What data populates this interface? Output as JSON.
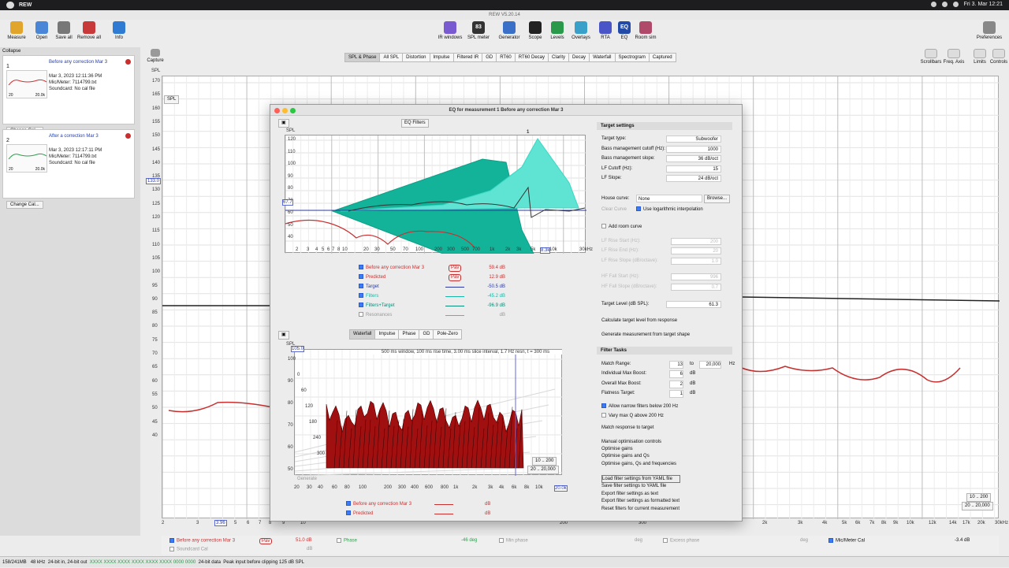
{
  "menubar": {
    "app": "REW",
    "clock": "Fri 3. Mar 12:21"
  },
  "window_title": "REW V5.20.14",
  "toolbar_left": [
    {
      "label": "Measure",
      "color": "#e2a52b"
    },
    {
      "label": "Open",
      "color": "#4a86d8"
    },
    {
      "label": "Save all",
      "color": "#777"
    },
    {
      "label": "Remove all",
      "color": "#c83a3a"
    },
    {
      "label": "Info",
      "color": "#2f7bd3"
    }
  ],
  "toolbar_mid": [
    {
      "label": "IR windows",
      "color": "#7a5ad0"
    },
    {
      "label": "SPL meter",
      "color": "#333",
      "text": "83"
    },
    {
      "label": "Generator",
      "color": "#3a70c8"
    },
    {
      "label": "Scope",
      "color": "#222"
    },
    {
      "label": "Levels",
      "color": "#2a9a4a"
    },
    {
      "label": "Overlays",
      "color": "#39a0c9"
    },
    {
      "label": "RTA",
      "color": "#4a56c8"
    },
    {
      "label": "EQ",
      "color": "#244aa8",
      "text": "EQ"
    },
    {
      "label": "Room sim",
      "color": "#b04a6a"
    }
  ],
  "preferences_label": "Preferences",
  "tabs": [
    "SPL & Phase",
    "All SPL",
    "Distortion",
    "Impulse",
    "Filtered IR",
    "GD",
    "RT60",
    "RT60 Decay",
    "Clarity",
    "Decay",
    "Waterfall",
    "Spectrogram",
    "Captured"
  ],
  "right_tools": [
    "Scrollbars",
    "Freq. Axis",
    "Limits",
    "Controls"
  ],
  "capture_label": "Capture",
  "collapse_label": "Collapse",
  "measurements": [
    {
      "index": "1",
      "name": "Before any correction Mar 3",
      "date": "Mar 3, 2023 12:11:36 PM",
      "mic": "Mic/Meter: 7114799.txt",
      "sound": "Soundcard: No cal file",
      "change": "Change Cal...",
      "color": "#d03030",
      "thumb_freq": "20.0k",
      "thumb_20": "20"
    },
    {
      "index": "2",
      "name": "After a correction Mar 3",
      "date": "Mar 3, 2023 12:17:11 PM",
      "mic": "Mic/Meter: 7114799.txt",
      "sound": "Soundcard: No cal file",
      "change": "Change Cal...",
      "color": "#2aa14a",
      "thumb_freq": "20.0k",
      "thumb_20": "20"
    }
  ],
  "main_graph": {
    "y_title": "SPL",
    "y_mode": "SPL",
    "y_ticks": [
      "170",
      "165",
      "160",
      "155",
      "150",
      "145",
      "140",
      "135",
      "130",
      "125",
      "120",
      "115",
      "110",
      "105",
      "100",
      "95",
      "90",
      "85",
      "80",
      "75",
      "70",
      "65",
      "60",
      "55",
      "50",
      "45",
      "40"
    ],
    "cursor_y": "133.0",
    "x_ticks": [
      "2",
      "3",
      "4",
      "5",
      "6",
      "7",
      "8",
      "9",
      "10",
      "2k",
      "3k",
      "4k",
      "5k",
      "6k",
      "7k",
      "8k",
      "9k",
      "10k",
      "12k",
      "14k",
      "17k",
      "20k",
      "30kHz"
    ],
    "cursor_x": "3.96",
    "x_200": "200",
    "x_300": "300",
    "range_a": "10 .. 200",
    "range_b": "20 .. 20,000"
  },
  "eq_window": {
    "title": "EQ for measurement 1 Before any correction Mar 3",
    "eq_filters_btn": "EQ Filters",
    "top_plot": {
      "y_label": "SPL",
      "y_ticks": [
        "120",
        "110",
        "100",
        "90",
        "80",
        "70",
        "60",
        "50",
        "40"
      ],
      "cursor_y": "67.7",
      "x_ticks": [
        "2",
        "3",
        "4",
        "5",
        "6",
        "7",
        "8",
        "10",
        "20",
        "30",
        "50",
        "70",
        "100",
        "200",
        "300",
        "500",
        "700",
        "1k",
        "2k",
        "3k",
        "5k",
        "10k",
        "30kHz"
      ],
      "cursor_x": "8.3k",
      "marker": "1"
    },
    "top_legend": [
      {
        "name": "Before any correction Mar 3",
        "value": "59.4 dB",
        "color": "#c83030",
        "checked": true,
        "badge": "Pav"
      },
      {
        "name": "Predicted",
        "value": "12.9 dB",
        "color": "#c83030",
        "checked": true,
        "badge": "Pav"
      },
      {
        "name": "Target",
        "value": "-50.5 dB",
        "color": "#2c3aa0",
        "checked": true,
        "badge": ""
      },
      {
        "name": "Filters",
        "value": "-45.2 dB",
        "color": "#17b8a8",
        "checked": true,
        "badge": ""
      },
      {
        "name": "Filters+Target",
        "value": "-96.9 dB",
        "color": "#0a8a78",
        "checked": true,
        "badge": ""
      },
      {
        "name": "Resonances",
        "value": "dB",
        "color": "#999",
        "checked": false,
        "badge": ""
      }
    ],
    "bottom_tabs": [
      "Waterfall",
      "Impulse",
      "Phase",
      "GD",
      "Pole-Zero"
    ],
    "waterfall": {
      "caption": "500 ms window, 100 ms rise time, 3.00 ms slice interval, 1.7 Hz resn, t = 300 ms",
      "y_label": "SPL",
      "y_top": "105.0",
      "y_ticks": [
        "100",
        "90",
        "80",
        "70",
        "60",
        "50"
      ],
      "t_ticks": [
        "0",
        "60",
        "120",
        "180",
        "240",
        "300"
      ],
      "x_ticks": [
        "20",
        "30",
        "40",
        "60",
        "80",
        "100",
        "200",
        "300",
        "400",
        "600",
        "800",
        "1k",
        "2k",
        "3k",
        "4k",
        "6k",
        "8k",
        "10k"
      ],
      "cursor_x": "20.0k",
      "range_a": "10 .. 200",
      "range_b": "20 .. 20,000",
      "generate": "Generate"
    },
    "bottom_legend": [
      {
        "name": "Before any correction Mar 3",
        "value": "dB",
        "color": "#c83030"
      },
      {
        "name": "Predicted",
        "value": "dB",
        "color": "#c83030"
      }
    ],
    "settings": {
      "section_target": "Target settings",
      "rows": [
        {
          "label": "Target type:",
          "value": "Subwoofer"
        },
        {
          "label": "Bass management cutoff (Hz):",
          "value": "1000"
        },
        {
          "label": "Bass management slope:",
          "value": "36 dB/oct"
        },
        {
          "label": "LF Cutoff (Hz):",
          "value": "15"
        },
        {
          "label": "LF Slope:",
          "value": "24 dB/oct"
        }
      ],
      "house_curve_label": "House curve:",
      "house_curve_value": "None",
      "browse": "Browse...",
      "clear_curve": "Clear Curve",
      "log_interp": "Use logarithmic interpolation",
      "add_room_curve": "Add room curve",
      "disabled_rows": [
        {
          "label": "LF Rise Start (Hz):",
          "value": "200"
        },
        {
          "label": "LF Rise End (Hz):",
          "value": "20"
        },
        {
          "label": "LF Rise Slope (dB/octave):",
          "value": "1.0"
        },
        {
          "label": "HF Fall Start (Hz):",
          "value": "996"
        },
        {
          "label": "HF Fall Slope (dB/octave):",
          "value": "0.7"
        }
      ],
      "target_level_label": "Target Level (dB SPL):",
      "target_level": "61.3",
      "calc_target": "Calculate target level from response",
      "gen_measure": "Generate measurement from target shape",
      "section_filter": "Filter Tasks",
      "match_range_label": "Match Range:",
      "match_from": "13",
      "match_to_label": "to",
      "match_to": "20,000",
      "hz": "Hz",
      "task_rows": [
        {
          "label": "Individual Max Boost:",
          "value": "6",
          "unit": "dB"
        },
        {
          "label": "Overall Max Boost:",
          "value": "2",
          "unit": "dB"
        },
        {
          "label": "Flatness Target:",
          "value": "1",
          "unit": "dB"
        }
      ],
      "allow_narrow": "Allow narrow filters below 200 Hz",
      "vary_q": "Vary max Q above 200 Hz",
      "actions": [
        "Match response to target",
        "Manual optimisation controls",
        "Optimise gains",
        "Optimise gains and Qs",
        "Optimise gains, Qs and frequencies",
        "Load filter settings from YAML file",
        "Save filter settings to YAML file",
        "Export filter settings as text",
        "Export filter settings as formatted text",
        "Reset filters for current measurement"
      ]
    }
  },
  "bottom_legend": {
    "name": "Before any correction Mar 3",
    "badge": "Pav",
    "value": "51.0 dB",
    "phase": "Phase",
    "phase_val": "-46 deg",
    "min_phase": "Min phase",
    "deg1": "deg",
    "excess": "Excess phase",
    "deg2": "deg",
    "mic_cal": "Mic/Meter Cal",
    "mic_val": "-3.4 dB",
    "sound_cal": "Soundcard Cal",
    "sound_val": "dB"
  },
  "status": {
    "mem": "158/241MB",
    "rate": "48 kHz",
    "bits": "24-bit in, 24-bit out",
    "pattern": "XXXX XXXX  XXXX XXXX  XXXX XXXX  0000 0000",
    "data": "24-bit data",
    "peak": "Peak input before clipping 125 dB SPL"
  }
}
